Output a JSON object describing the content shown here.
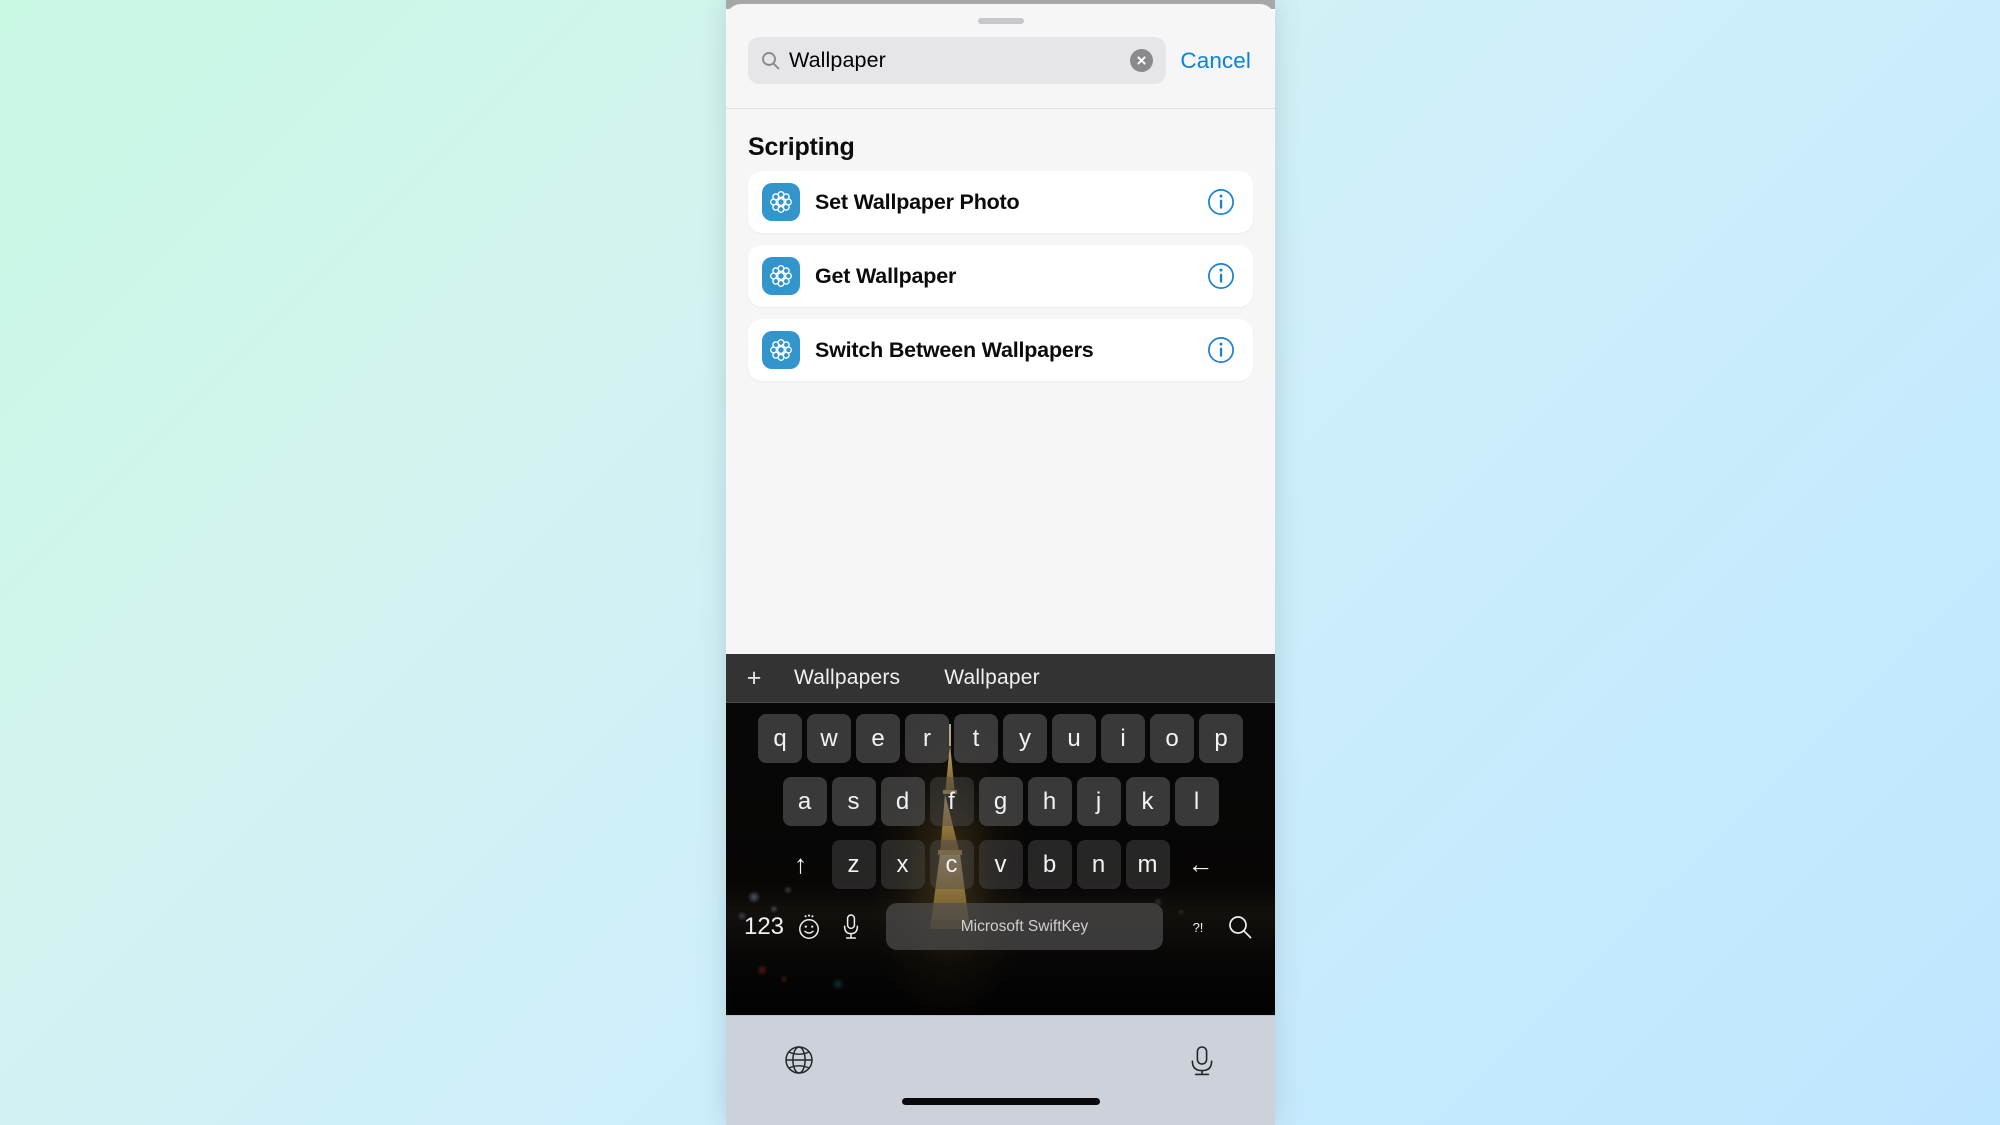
{
  "background": {
    "gradient_from": "#c9f8e3",
    "gradient_to": "#bfe6ff"
  },
  "sheet": {
    "search": {
      "value": "Wallpaper",
      "placeholder": "Search",
      "search_icon": "search-icon",
      "clear_icon": "clear-circle-icon",
      "cancel_label": "Cancel",
      "cancel_color": "#0a84d6"
    },
    "section": {
      "header": "Scripting",
      "items": [
        {
          "label": "Set Wallpaper Photo",
          "icon": "shortcuts-scripting-icon",
          "info": "info-icon"
        },
        {
          "label": "Get Wallpaper",
          "icon": "shortcuts-scripting-icon",
          "info": "info-icon"
        },
        {
          "label": "Switch Between Wallpapers",
          "icon": "shortcuts-scripting-icon",
          "info": "info-icon"
        }
      ]
    },
    "icon_color": "#3296cc"
  },
  "keyboard": {
    "suggestions": {
      "add_label": "+",
      "words": [
        "Wallpapers",
        "Wallpaper"
      ]
    },
    "rows": [
      [
        "q",
        "w",
        "e",
        "r",
        "t",
        "y",
        "u",
        "i",
        "o",
        "p"
      ],
      [
        "a",
        "s",
        "d",
        "f",
        "g",
        "h",
        "j",
        "k",
        "l"
      ],
      [
        "z",
        "x",
        "c",
        "v",
        "b",
        "n",
        "m"
      ]
    ],
    "shift_label": "↑",
    "backspace_label": "←",
    "bottom": {
      "numeric_label": "123",
      "emoji_icon": "emoji-smiley-icon",
      "mic_icon": "microphone-icon",
      "space_label": "Microsoft SwiftKey",
      "punctuation_label": "?!",
      "search_icon": "search-icon"
    }
  },
  "navbar": {
    "globe_icon": "globe-icon",
    "mic_icon": "microphone-icon",
    "home_indicator": "home-indicator"
  }
}
